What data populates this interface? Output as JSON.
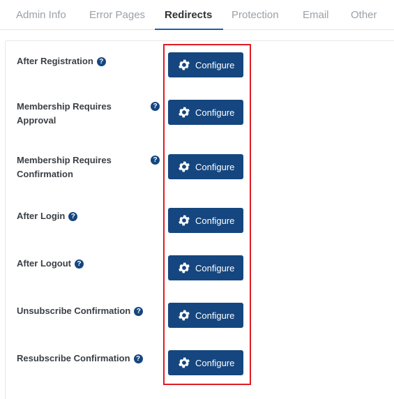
{
  "tabs": [
    {
      "label": "Admin Info",
      "active": false
    },
    {
      "label": "Error Pages",
      "active": false
    },
    {
      "label": "Redirects",
      "active": true
    },
    {
      "label": "Protection",
      "active": false
    },
    {
      "label": "Email",
      "active": false
    },
    {
      "label": "Other",
      "active": false
    }
  ],
  "redirects": [
    {
      "label": "After Registration",
      "button": "Configure"
    },
    {
      "label": "Membership Requires Approval",
      "button": "Configure"
    },
    {
      "label": "Membership Requires Confirmation",
      "button": "Configure"
    },
    {
      "label": "After Login",
      "button": "Configure"
    },
    {
      "label": "After Logout",
      "button": "Configure"
    },
    {
      "label": "Unsubscribe Confirmation",
      "button": "Configure"
    },
    {
      "label": "Resubscribe Confirmation",
      "button": "Configure"
    }
  ],
  "help_glyph": "?",
  "icons": {
    "help": "help-circle-icon",
    "configure": "gear-icon"
  },
  "colors": {
    "button": "#15467f",
    "active_tab_underline": "#1f5fa8",
    "highlight_box": "#e11b22"
  }
}
